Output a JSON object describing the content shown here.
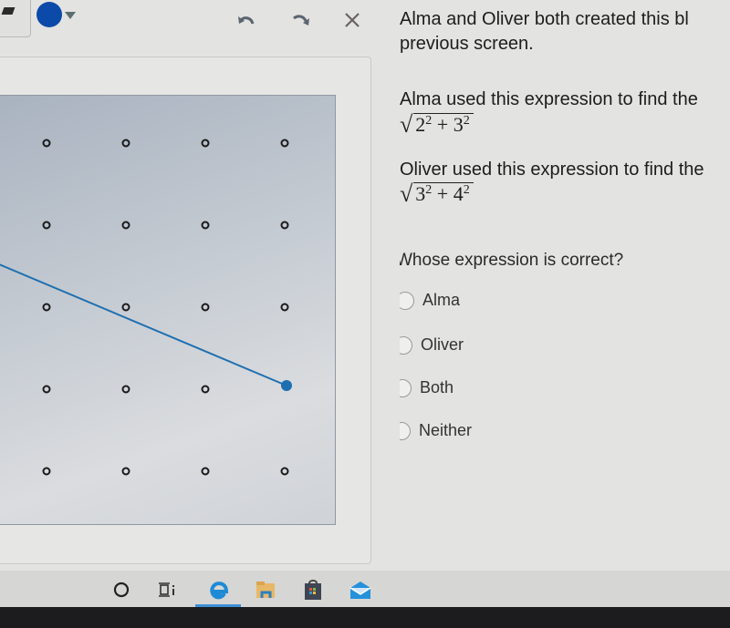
{
  "toolbar": {
    "pen_icon": "pen-icon",
    "color_icon": "color-swatch",
    "selected_color": "#0b4aa8",
    "undo_icon": "undo-icon",
    "redo_icon": "redo-icon",
    "close_icon": "close-icon"
  },
  "geoboard": {
    "columns": 4,
    "rows": 5,
    "segment": {
      "from": [
        0,
        1.7
      ],
      "to": [
        3,
        3
      ]
    },
    "line_color": "#1e6fb0"
  },
  "question": {
    "intro_line1": "Alma and Oliver both created this bl",
    "intro_line2": "previous screen.",
    "alma_line": "Alma used this expression to find the",
    "alma_expr": {
      "a": "2",
      "b": "3",
      "exp": "2",
      "op": "+"
    },
    "oliver_line": "Oliver used this expression to find the",
    "oliver_expr": {
      "a": "3",
      "b": "4",
      "exp": "2",
      "op": "+"
    },
    "prompt": "Whose expression is correct?",
    "options": [
      "Alma",
      "Oliver",
      "Both",
      "Neither"
    ]
  },
  "taskbar": {
    "items": [
      "cortana-icon",
      "task-view-icon",
      "edge-icon",
      "file-explorer-icon",
      "store-icon",
      "mail-icon"
    ],
    "active": "edge-icon"
  }
}
